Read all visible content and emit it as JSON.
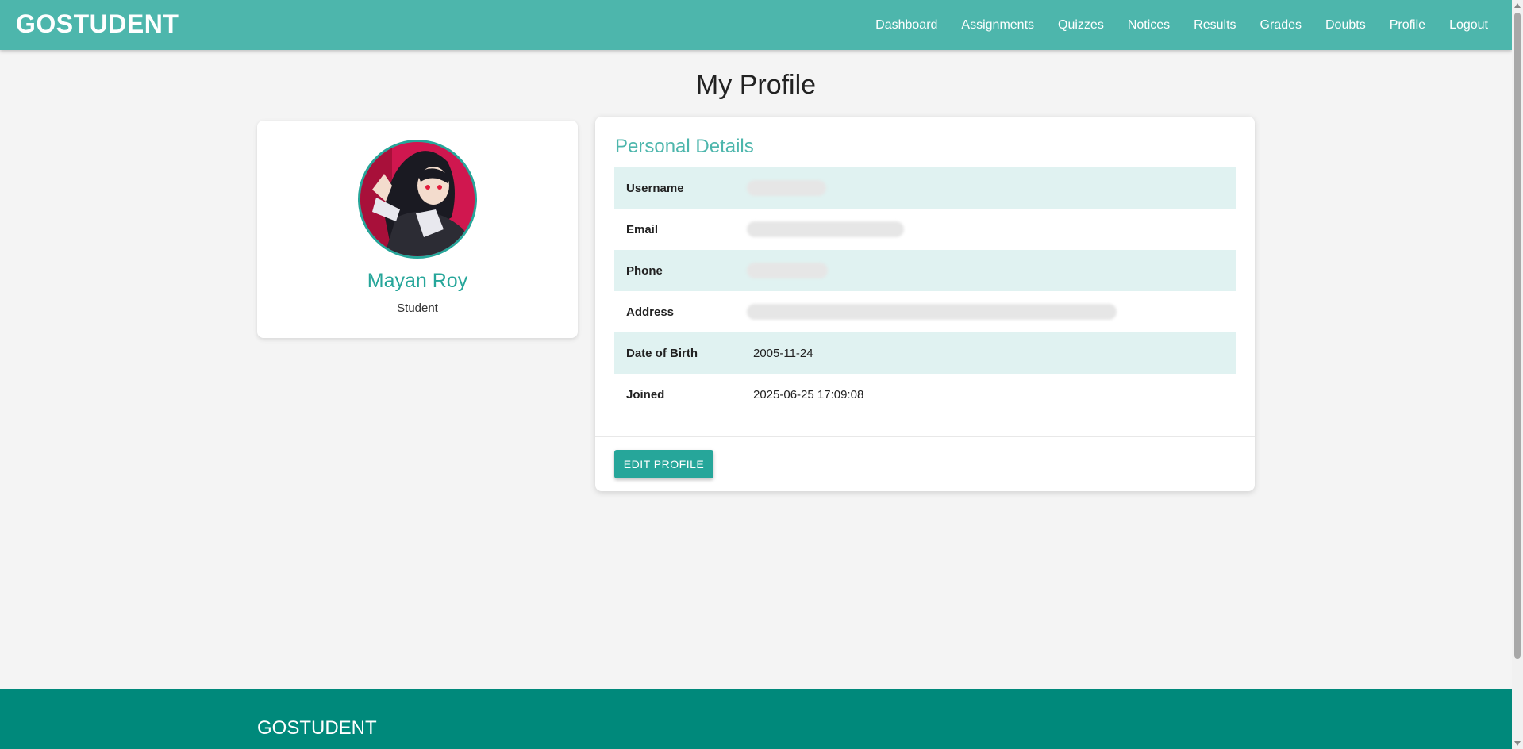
{
  "nav": {
    "brand": "GOSTUDENT",
    "links": [
      "Dashboard",
      "Assignments",
      "Quizzes",
      "Notices",
      "Results",
      "Grades",
      "Doubts",
      "Profile",
      "Logout"
    ]
  },
  "page": {
    "title": "My Profile"
  },
  "profile": {
    "name": "Mayan Roy",
    "role": "Student"
  },
  "details": {
    "title": "Personal Details",
    "rows": [
      {
        "label": "Username",
        "value": ""
      },
      {
        "label": "Email",
        "value": ""
      },
      {
        "label": "Phone",
        "value": ""
      },
      {
        "label": "Address",
        "value": ""
      },
      {
        "label": "Date of Birth",
        "value": "2005-11-24"
      },
      {
        "label": "Joined",
        "value": "2025-06-25 17:09:08"
      }
    ],
    "edit_label": "EDIT PROFILE"
  },
  "footer": {
    "brand": "GOSTUDENT"
  },
  "colors": {
    "accent": "#4db6ac",
    "primary": "#26a69a",
    "footer": "#00897b",
    "row_alt": "#e0f2f1"
  }
}
